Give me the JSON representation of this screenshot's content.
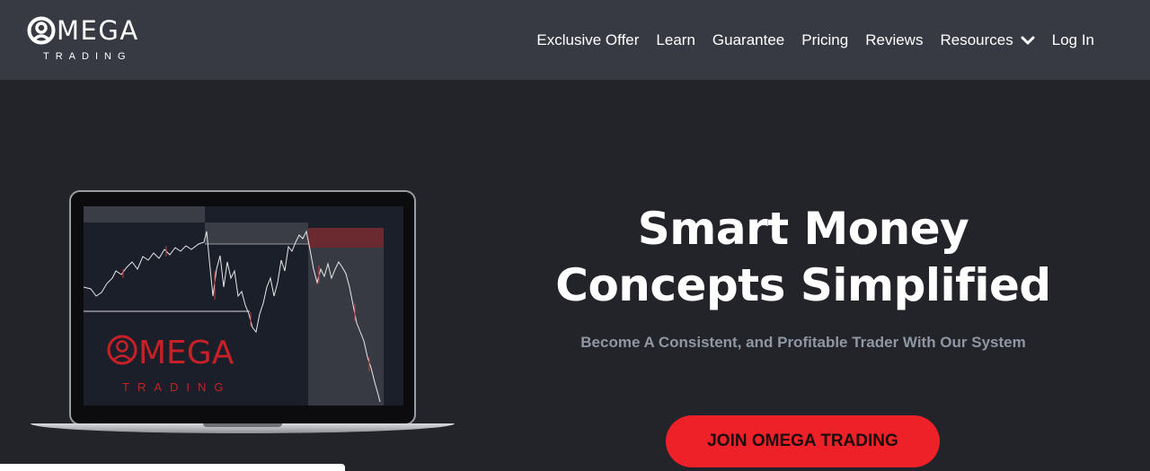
{
  "brand": {
    "name": "MEGA",
    "sub": "TRADING",
    "screen_logo_name": "MEGA",
    "screen_logo_sub": "TRADING"
  },
  "nav": {
    "items": [
      {
        "label": "Exclusive Offer"
      },
      {
        "label": "Learn"
      },
      {
        "label": "Guarantee"
      },
      {
        "label": "Pricing"
      },
      {
        "label": "Reviews"
      },
      {
        "label": "Resources",
        "has_dropdown": true,
        "icon": "chevron-down-icon"
      },
      {
        "label": "Log In"
      }
    ]
  },
  "hero": {
    "title_line1": "Smart Money",
    "title_line2": "Concepts Simplified",
    "subtitle": "Become A Consistent, and Profitable Trader With Our System",
    "cta_label": "JOIN OMEGA TRADING"
  },
  "colors": {
    "header_bg": "#383a43",
    "page_bg": "#23232a",
    "accent": "#ee2028",
    "subtitle": "#8f97a3"
  }
}
